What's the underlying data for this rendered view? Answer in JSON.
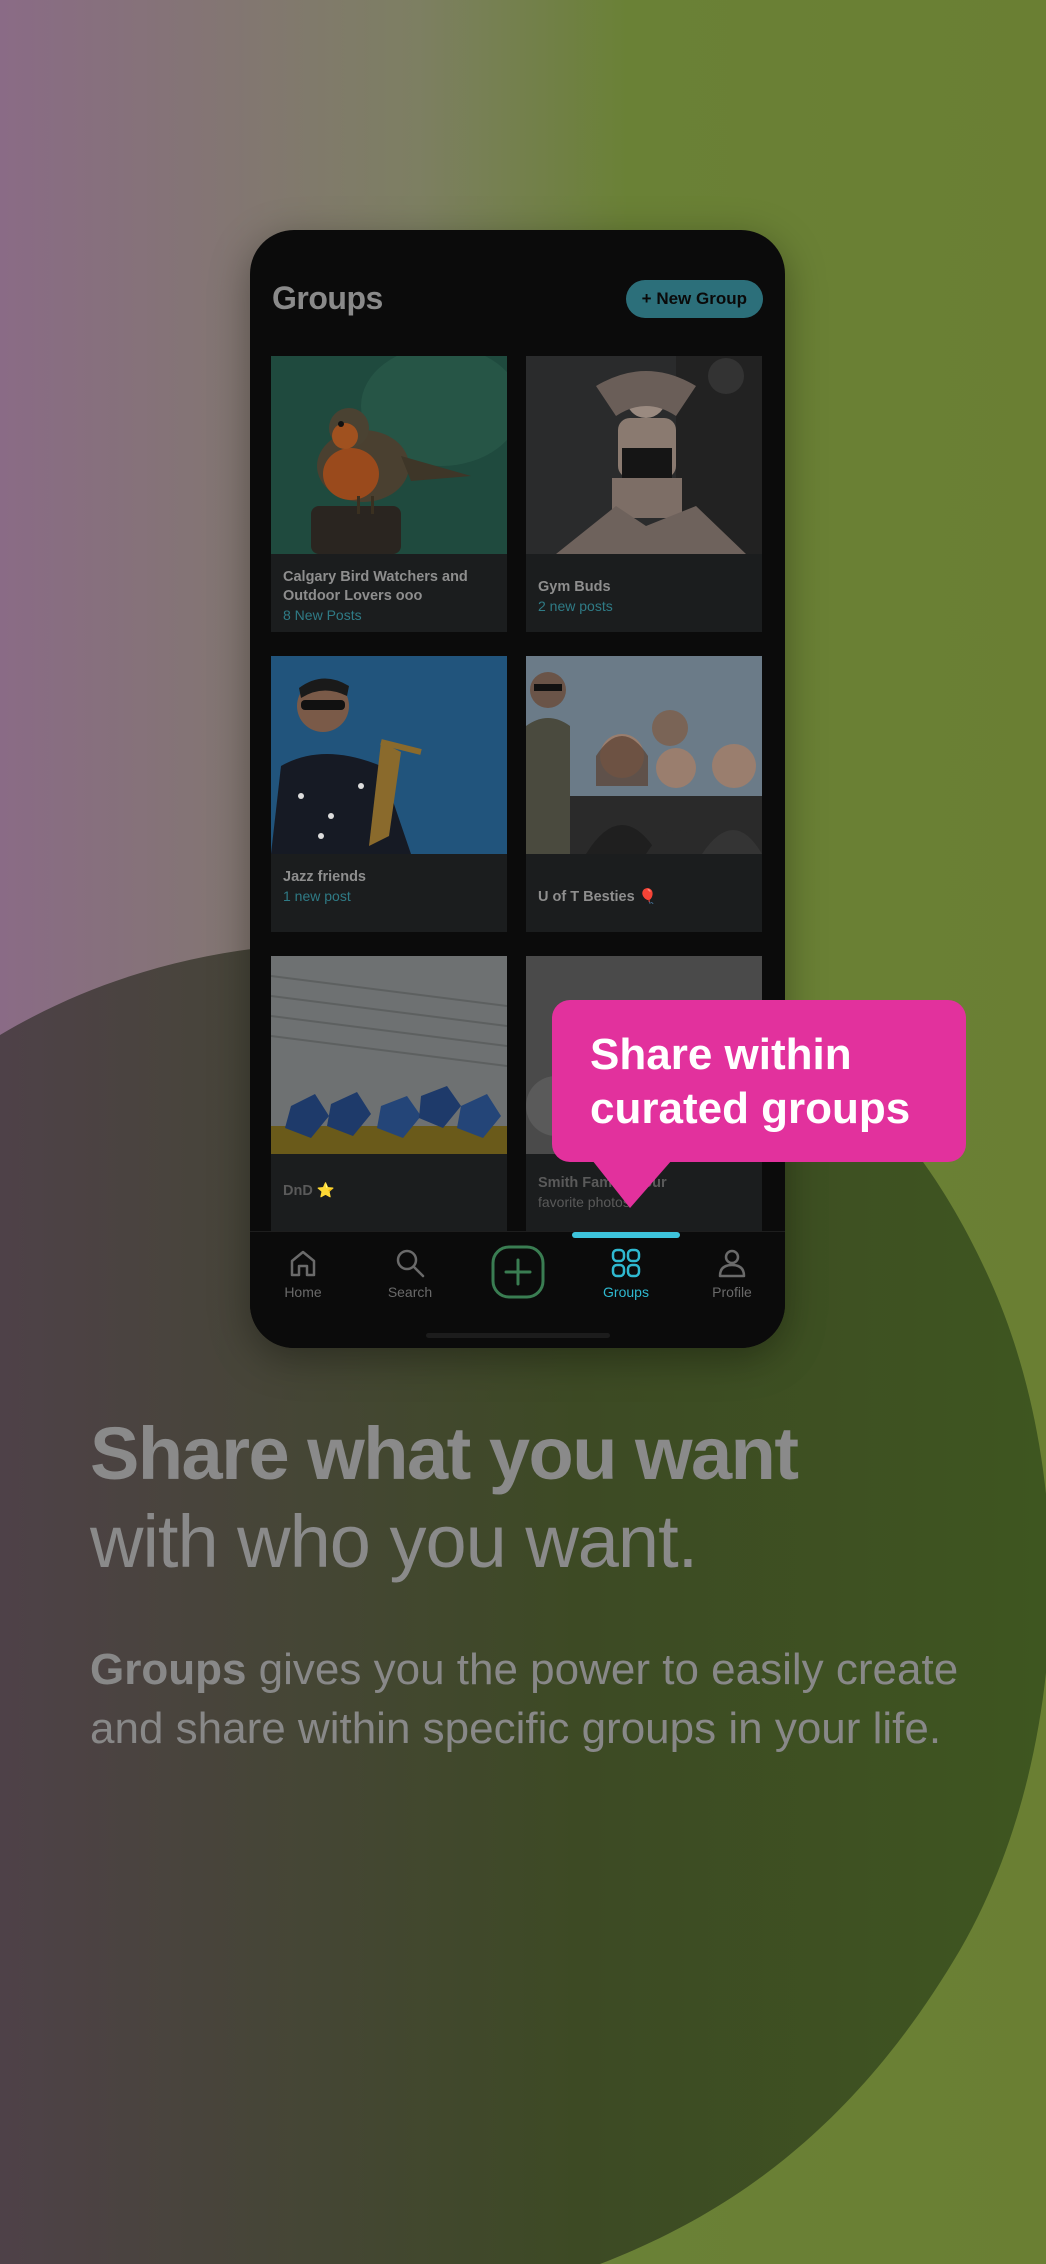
{
  "colors": {
    "accent_teal": "#2fb9d0",
    "bubble_pink": "#e2319d",
    "new_group_button": "#2c6f7a",
    "phone_bg": "#0b0b0b"
  },
  "header": {
    "title": "Groups",
    "new_group_label": "+ New Group"
  },
  "groups": [
    {
      "name": "Calgary Bird Watchers and Outdoor Lovers ooo",
      "posts": "8 New Posts",
      "image": "robin-bird-photo"
    },
    {
      "name": "Gym Buds",
      "posts": "2 new posts",
      "image": "gym-athlete-photo"
    },
    {
      "name": "Jazz friends",
      "posts": "1 new post",
      "image": "saxophone-player-photo"
    },
    {
      "name": "U of T Besties 🎈",
      "posts": "",
      "image": "friends-group-photo"
    },
    {
      "name": "DnD ⭐",
      "posts": "",
      "image": "dice-and-paper-photo"
    },
    {
      "name": "Smith Family... our",
      "posts": "favorite photos",
      "image": "family-portrait-photo"
    }
  ],
  "tabbar": {
    "items": [
      {
        "label": "Home",
        "icon": "home-icon"
      },
      {
        "label": "Search",
        "icon": "search-icon"
      },
      {
        "label": "",
        "icon": "plus-icon"
      },
      {
        "label": "Groups",
        "icon": "grid-icon"
      },
      {
        "label": "Profile",
        "icon": "profile-icon"
      }
    ],
    "active": "Groups"
  },
  "bubble": {
    "line1": "Share within",
    "line2": "curated groups"
  },
  "headline": {
    "bold": "Share what you want",
    "light": "with who you want."
  },
  "body_copy": {
    "bold": "Groups",
    "rest": " gives you the power to easily create and share within specific groups in your life."
  }
}
